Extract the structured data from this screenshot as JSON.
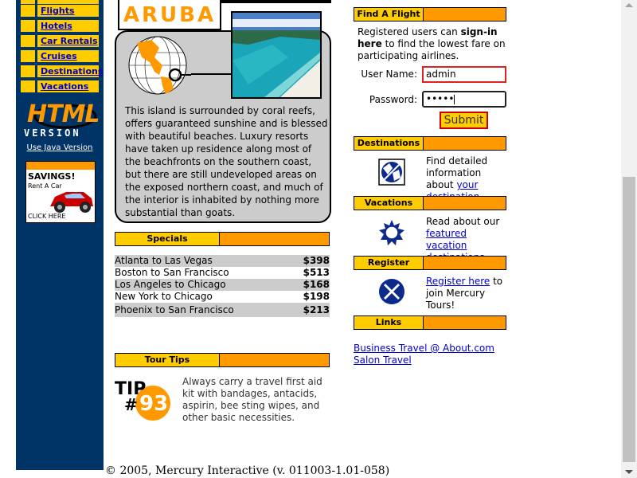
{
  "sidebar": {
    "items": [
      {
        "label": "Flights"
      },
      {
        "label": "Hotels"
      },
      {
        "label": "Car Rentals"
      },
      {
        "label": "Cruises"
      },
      {
        "label": "Destinations"
      },
      {
        "label": "Vacations"
      }
    ],
    "logo_html": "HTML",
    "logo_version": "VERSION",
    "java_link": "Use Java Version",
    "ad": {
      "title": "SAVINGS!",
      "subtitle": "Rent A Car",
      "cta": "CLICK HERE"
    }
  },
  "feature": {
    "title": "ARUBA",
    "description": "This island is surrounded by coral reefs, offers guaranteed sunshine and is blessed with beautiful beaches. Luxury resorts have taken up residence along most of the beachfronts on the southern coast, but there are still undeveloped areas on the exposed northern coast, and much of the interior is inhabited by nothing more substantial than goats."
  },
  "specials": {
    "label": "Specials",
    "rows": [
      {
        "route": "Atlanta to Las Vegas",
        "price": "$398"
      },
      {
        "route": "Boston to San Francisco",
        "price": "$513"
      },
      {
        "route": "Los Angeles to Chicago",
        "price": "$168"
      },
      {
        "route": "New York to Chicago",
        "price": "$198"
      },
      {
        "route": "Phoenix to San Francisco",
        "price": "$213"
      }
    ]
  },
  "tour_tips": {
    "label": "Tour Tips",
    "badge_word": "TIP",
    "badge_hash": "#",
    "badge_number": "93",
    "text": "Always carry a travel first aid kit with bandages, antacids, aspirin, bee sting wipes, and other basic necessities."
  },
  "find_flight": {
    "label": "Find A Flight",
    "intro_1": "Registered users can ",
    "intro_bold": "sign-in here",
    "intro_2": " to find the lowest fare on participating airlines.",
    "username_label": "User Name:",
    "username_value": "admin",
    "password_label": "Password:",
    "password_value": "•••••",
    "submit": "Submit"
  },
  "destinations": {
    "label": "Destinations",
    "text_1": "Find detailed information about ",
    "link": "your destination",
    "text_2": "."
  },
  "vacations": {
    "label": "Vacations",
    "text_1": "Read about our ",
    "link": "featured vacation destinations",
    "text_2": "."
  },
  "register": {
    "label": "Register",
    "link": "Register here",
    "text_2": " to join Mercury Tours!"
  },
  "links": {
    "label": "Links",
    "items": [
      "Business Travel @ About.com",
      "Salon Travel"
    ]
  },
  "footer": "© 2005, Mercury Interactive (v. 011003-1.01-058)",
  "colors": {
    "navy": "#003366",
    "orange": "#ff9900",
    "yellow": "#ffcc00",
    "link": "#0000cc"
  }
}
